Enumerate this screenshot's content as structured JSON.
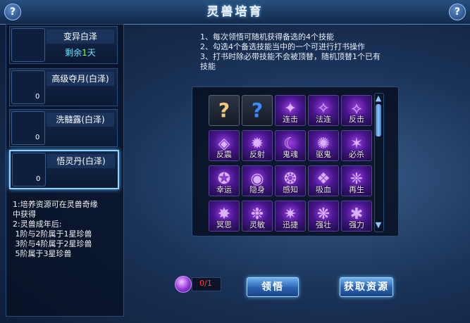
{
  "window": {
    "title": "灵兽培育",
    "help_label": "?",
    "close_label": "?"
  },
  "items": [
    {
      "name": "变异白泽",
      "remaining_prefix": "剩余",
      "remaining_value": "1",
      "remaining_suffix": "天",
      "icon": "beast-portrait-icon"
    },
    {
      "name": "高级夺月(白泽)",
      "count": "0",
      "icon": "crescent-moon-item-icon"
    },
    {
      "name": "洗髓露(白泽)",
      "count": "0",
      "icon": "potion-item-icon"
    },
    {
      "name": "悟灵丹(白泽)",
      "count": "0",
      "icon": "purple-orb-item-icon",
      "selected": true
    }
  ],
  "notes": [
    "1:培养资源可在灵兽奇缘",
    "中获得",
    "2:灵兽成年后:",
    " 1阶与2阶属于1星珍兽",
    " 3阶与4阶属于2星珍兽",
    " 5阶属于3星珍兽"
  ],
  "instructions": [
    "1、每次领悟可随机获得备选的4个技能",
    "2、勾选4个备选技能当中的一个可进行打书操作",
    "3、打书时除必带技能不会被顶替，随机顶替1个已有",
    "技能"
  ],
  "skills": [
    {
      "label": "",
      "glyph": "?",
      "type": "unknown",
      "color": "#f5c97a"
    },
    {
      "label": "",
      "glyph": "?",
      "type": "unknown",
      "color": "#3a8cff"
    },
    {
      "label": "连击",
      "glyph": "✦"
    },
    {
      "label": "法连",
      "glyph": "✧"
    },
    {
      "label": "反击",
      "glyph": "⟡"
    },
    {
      "label": "反震",
      "glyph": "◈"
    },
    {
      "label": "反射",
      "glyph": "✹"
    },
    {
      "label": "鬼魂",
      "glyph": "☾"
    },
    {
      "label": "驱鬼",
      "glyph": "✺"
    },
    {
      "label": "必杀",
      "glyph": "✶"
    },
    {
      "label": "幸运",
      "glyph": "✪"
    },
    {
      "label": "隐身",
      "glyph": "◉"
    },
    {
      "label": "感知",
      "glyph": "❂"
    },
    {
      "label": "吸血",
      "glyph": "❖"
    },
    {
      "label": "再生",
      "glyph": "❈"
    },
    {
      "label": "冥思",
      "glyph": "✸"
    },
    {
      "label": "灵敏",
      "glyph": "❉"
    },
    {
      "label": "迅捷",
      "glyph": "✷"
    },
    {
      "label": "强壮",
      "glyph": "❋"
    },
    {
      "label": "强力",
      "glyph": "✱"
    }
  ],
  "resource": {
    "count": "0/1",
    "icon": "purple-orb-icon"
  },
  "buttons": {
    "enlighten": "领悟",
    "get_resources": "获取资源"
  },
  "scroll": {
    "up": "▲",
    "down": "▼"
  }
}
